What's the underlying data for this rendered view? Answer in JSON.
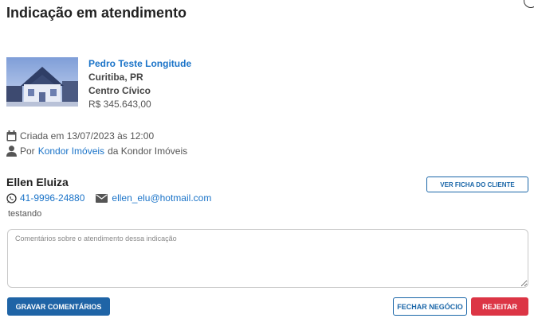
{
  "header": {
    "title": "Indicação em atendimento"
  },
  "property": {
    "name": "Pedro Teste Longitude",
    "city": "Curitiba, PR",
    "district": "Centro Cívico",
    "price": "R$ 345.643,00"
  },
  "meta": {
    "created": "Criada em 13/07/2023 às 12:00",
    "by_prefix": "Por",
    "agent": "Kondor Imóveis",
    "agency_suffix": "da Kondor Imóveis"
  },
  "client": {
    "name": "Ellen Eluiza",
    "view_button": "Ver ficha do cliente",
    "phone": "41-9996-24880",
    "email": "ellen_elu@hotmail.com",
    "note": "testando"
  },
  "comment": {
    "placeholder": "Comentários sobre o atendimento dessa indicação",
    "value": ""
  },
  "actions": {
    "save": "Gravar comentários",
    "close_deal": "Fechar negócio",
    "reject": "Rejeitar"
  },
  "colors": {
    "link": "#1a73c8",
    "primary": "#1f64a6",
    "danger": "#dc3545"
  },
  "icons": [
    "calendar-icon",
    "user-icon",
    "whatsapp-icon",
    "envelope-icon",
    "close-icon"
  ]
}
